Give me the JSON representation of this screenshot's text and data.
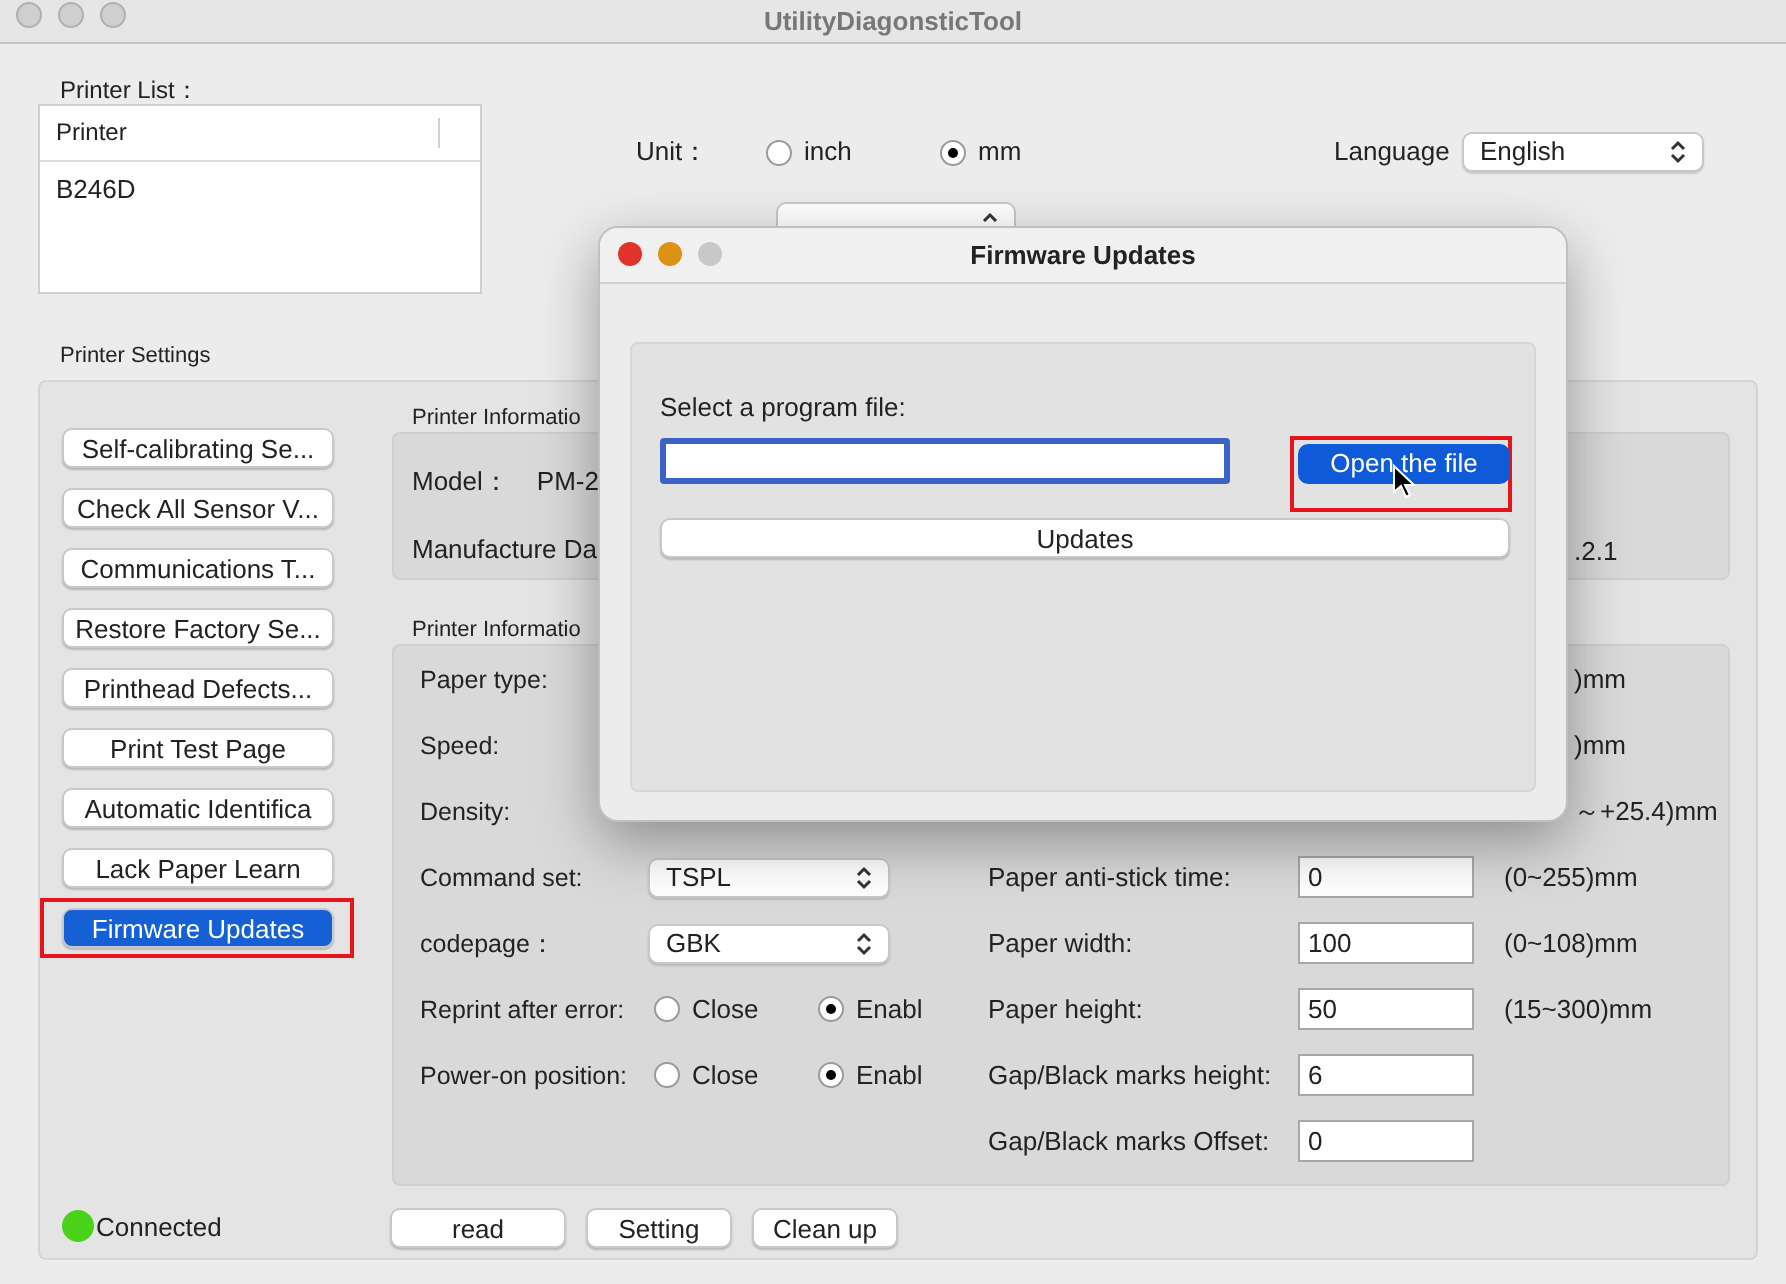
{
  "window": {
    "title": "UtilityDiagonsticTool"
  },
  "printer_list": {
    "label": "Printer List：",
    "columns": [
      "Printer"
    ],
    "rows": [
      "B246D"
    ]
  },
  "unit": {
    "label": "Unit：",
    "options": [
      {
        "label": "inch",
        "selected": false
      },
      {
        "label": "mm",
        "selected": true
      }
    ]
  },
  "language": {
    "label": "Language",
    "value": "English"
  },
  "printer_settings": {
    "label": "Printer Settings",
    "actions": [
      {
        "label": "Self-calibrating Se...",
        "selected": false,
        "highlighted": false
      },
      {
        "label": "Check All Sensor V...",
        "selected": false,
        "highlighted": false
      },
      {
        "label": "Communications T...",
        "selected": false,
        "highlighted": false
      },
      {
        "label": "Restore Factory Se...",
        "selected": false,
        "highlighted": false
      },
      {
        "label": "Printhead Defects...",
        "selected": false,
        "highlighted": false
      },
      {
        "label": "Print Test Page",
        "selected": false,
        "highlighted": false
      },
      {
        "label": "Automatic Identifica",
        "selected": false,
        "highlighted": false
      },
      {
        "label": "Lack Paper Learn",
        "selected": false,
        "highlighted": false
      },
      {
        "label": "Firmware Updates",
        "selected": true,
        "highlighted": true
      }
    ],
    "connection": {
      "label": "Connected",
      "color": "#4ad21a"
    },
    "device_info": {
      "label": "Printer Informatio",
      "model_label": "Model：",
      "model_value": "PM-2",
      "date_label": "Manufacture Da",
      "date_value": ".2.1"
    },
    "parameters": {
      "label": "Printer Informatio",
      "rows": [
        {
          "kind": "text",
          "label": "Paper type:",
          "range": ")mm"
        },
        {
          "kind": "text",
          "label": "Speed:",
          "range": ")mm"
        },
        {
          "kind": "text",
          "label": "Density:",
          "range": "～+25.4)mm"
        },
        {
          "kind": "select",
          "label": "Command set:",
          "value": "TSPL",
          "field": {
            "label": "Paper anti-stick time:",
            "value": "0",
            "range": "(0~255)mm"
          }
        },
        {
          "kind": "select",
          "label": "codepage：",
          "value": "GBK",
          "field": {
            "label": "Paper width:",
            "value": "100",
            "range": "(0~108)mm"
          }
        },
        {
          "kind": "radio",
          "label": "Reprint after error:",
          "options": [
            {
              "label": "Close",
              "selected": false
            },
            {
              "label": "Enabl",
              "selected": true
            }
          ],
          "field": {
            "label": "Paper height:",
            "value": "50",
            "range": "(15~300)mm"
          }
        },
        {
          "kind": "radio",
          "label": "Power-on position:",
          "options": [
            {
              "label": "Close",
              "selected": false
            },
            {
              "label": "Enabl",
              "selected": true
            }
          ],
          "field": {
            "label": "Gap/Black marks height:",
            "value": "6"
          }
        },
        {
          "kind": "empty",
          "field": {
            "label": "Gap/Black marks Offset:",
            "value": "0"
          }
        }
      ]
    },
    "buttons": [
      "read",
      "Setting",
      "Clean up"
    ]
  },
  "dialog": {
    "title": "Firmware Updates",
    "prompt": "Select a program file:",
    "open_button": {
      "label": "Open the file",
      "highlighted": true
    },
    "update_button": "Updates"
  }
}
